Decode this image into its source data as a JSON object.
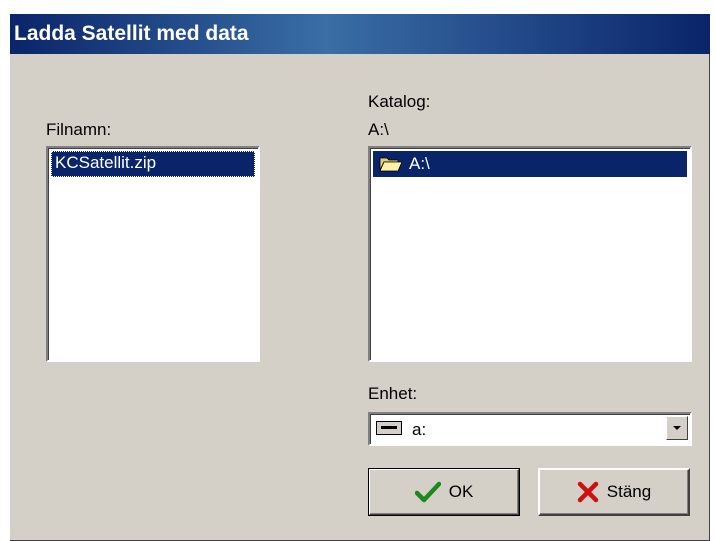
{
  "window": {
    "title": "Ladda Satellit med data"
  },
  "files": {
    "label": "Filnamn:",
    "items": [
      "KCSatellit.zip"
    ]
  },
  "directory": {
    "label": "Katalog:",
    "current_path": "A:\\",
    "items": [
      {
        "name": "A:\\",
        "icon": "open-folder-icon"
      }
    ]
  },
  "drive": {
    "label": "Enhet:",
    "selected": "a:",
    "icon": "floppy-drive-icon"
  },
  "buttons": {
    "ok_label": "OK",
    "ok_icon": "checkmark-icon",
    "close_label": "Stäng",
    "close_icon": "x-icon"
  },
  "colors": {
    "selection": "#0a246a",
    "dialog_bg": "#d4d0c8",
    "title_gradient_start": "#0a246a",
    "title_gradient_mid": "#3a6ea5",
    "ok_check": "#1b8a1b",
    "close_x": "#d01010"
  }
}
